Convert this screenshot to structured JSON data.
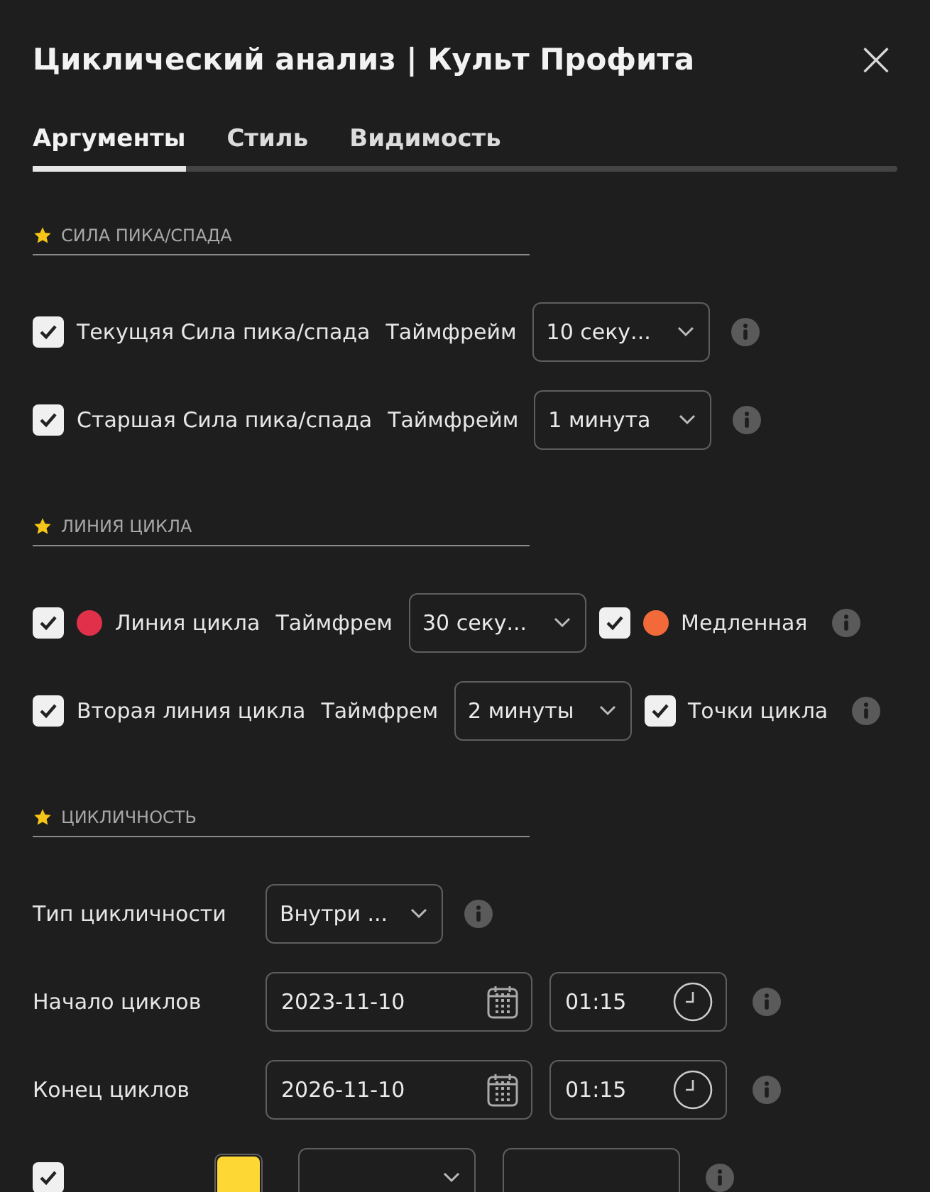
{
  "window": {
    "title": "Циклический анализ | Культ Профита",
    "close": "×"
  },
  "tabs": [
    {
      "label": "Аргументы",
      "selected": true
    },
    {
      "label": "Стиль",
      "selected": false
    },
    {
      "label": "Видимость",
      "selected": false
    }
  ],
  "sections": [
    {
      "title": "СИЛА ПИКА/СПАДА",
      "rows": [
        {
          "items": [
            {
              "kind": "checkbox",
              "checked": true
            },
            {
              "kind": "label",
              "text": "Текущяя Сила пика/спада"
            },
            {
              "kind": "label",
              "text": "Таймфрейм"
            },
            {
              "kind": "select",
              "value": "10 секу..."
            },
            {
              "kind": "info"
            }
          ]
        },
        {
          "items": [
            {
              "kind": "checkbox",
              "checked": true
            },
            {
              "kind": "label",
              "text": "Старшая Сила пика/спада"
            },
            {
              "kind": "label",
              "text": "Таймфрейм"
            },
            {
              "kind": "select",
              "value": "1 минута"
            },
            {
              "kind": "info"
            }
          ]
        }
      ]
    },
    {
      "title": "ЛИНИЯ ЦИКЛА",
      "rows": [
        {
          "items": [
            {
              "kind": "checkbox",
              "checked": true
            },
            {
              "kind": "dot",
              "color": "#e0304a"
            },
            {
              "kind": "label",
              "text": "Линия цикла"
            },
            {
              "kind": "label",
              "text": "Таймфрем"
            },
            {
              "kind": "select",
              "value": "30 секу..."
            },
            {
              "kind": "checkbox",
              "checked": true
            },
            {
              "kind": "dot",
              "color": "#f26a3a"
            },
            {
              "kind": "label",
              "text": "Медленная"
            },
            {
              "kind": "info"
            }
          ]
        },
        {
          "items": [
            {
              "kind": "checkbox",
              "checked": true
            },
            {
              "kind": "label",
              "text": "Вторая линия цикла"
            },
            {
              "kind": "label",
              "text": "Таймфрем"
            },
            {
              "kind": "select",
              "value": "2 минуты"
            },
            {
              "kind": "checkbox",
              "checked": true
            },
            {
              "kind": "label",
              "text": "Точки цикла"
            },
            {
              "kind": "info"
            }
          ]
        }
      ]
    },
    {
      "title": "ЦИКЛИЧНОСТЬ",
      "rows": [
        {
          "items": [
            {
              "kind": "fieldlabel",
              "text": "Тип цикличности"
            },
            {
              "kind": "select",
              "value": "Внутри ..."
            },
            {
              "kind": "info"
            }
          ]
        },
        {
          "items": [
            {
              "kind": "fieldlabel",
              "text": "Начало циклов"
            },
            {
              "kind": "date",
              "value": "2023-11-10"
            },
            {
              "kind": "time",
              "value": "01:15"
            },
            {
              "kind": "info"
            }
          ]
        },
        {
          "items": [
            {
              "kind": "fieldlabel",
              "text": "Конец циклов"
            },
            {
              "kind": "date",
              "value": "2026-11-10"
            },
            {
              "kind": "time",
              "value": "01:15"
            },
            {
              "kind": "info"
            }
          ]
        },
        {
          "items": [
            {
              "kind": "checkbox",
              "checked": true
            },
            {
              "kind": "spacer"
            },
            {
              "kind": "swatch",
              "color": "#fdd835"
            },
            {
              "kind": "select"
            },
            {
              "kind": "input"
            },
            {
              "kind": "info"
            }
          ]
        }
      ]
    }
  ]
}
